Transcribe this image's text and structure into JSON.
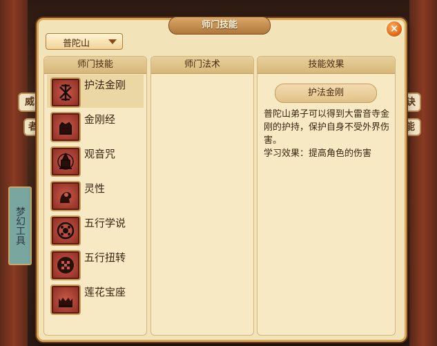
{
  "background": {
    "side_tab_left_1": "威",
    "side_tab_left_2": "者",
    "side_tab_right_1": "诀",
    "side_tab_right_2": "能",
    "left_sign": "梦幻工具"
  },
  "dialog": {
    "title": "师门技能",
    "close_symbol": "×",
    "school_select": {
      "value": "普陀山"
    }
  },
  "panels": {
    "skills_header": "师门技能",
    "spells_header": "师门法术",
    "effect_header": "技能效果"
  },
  "skills": [
    {
      "name": "护法金刚",
      "icon": "vajra-guardian-icon",
      "selected": true
    },
    {
      "name": "金刚经",
      "icon": "vajra-sutra-icon",
      "selected": false
    },
    {
      "name": "观音咒",
      "icon": "guanyin-mantra-icon",
      "selected": false
    },
    {
      "name": "灵性",
      "icon": "spirit-icon",
      "selected": false
    },
    {
      "name": "五行学说",
      "icon": "five-elements-theory-icon",
      "selected": false
    },
    {
      "name": "五行扭转",
      "icon": "five-elements-twist-icon",
      "selected": false
    },
    {
      "name": "莲花宝座",
      "icon": "lotus-throne-icon",
      "selected": false
    }
  ],
  "effect": {
    "skill_name": "护法金刚",
    "description": "普陀山弟子可以得到大雷音寺金刚的护持，保护自身不受外界伤害。",
    "learn_effect": "学习效果：提高角色的伤害"
  },
  "colors": {
    "accent": "#d9a85a",
    "panel_bg": "#f6e9c3",
    "selected_row": "#ead7a4",
    "icon_red": "#a83a2c"
  }
}
